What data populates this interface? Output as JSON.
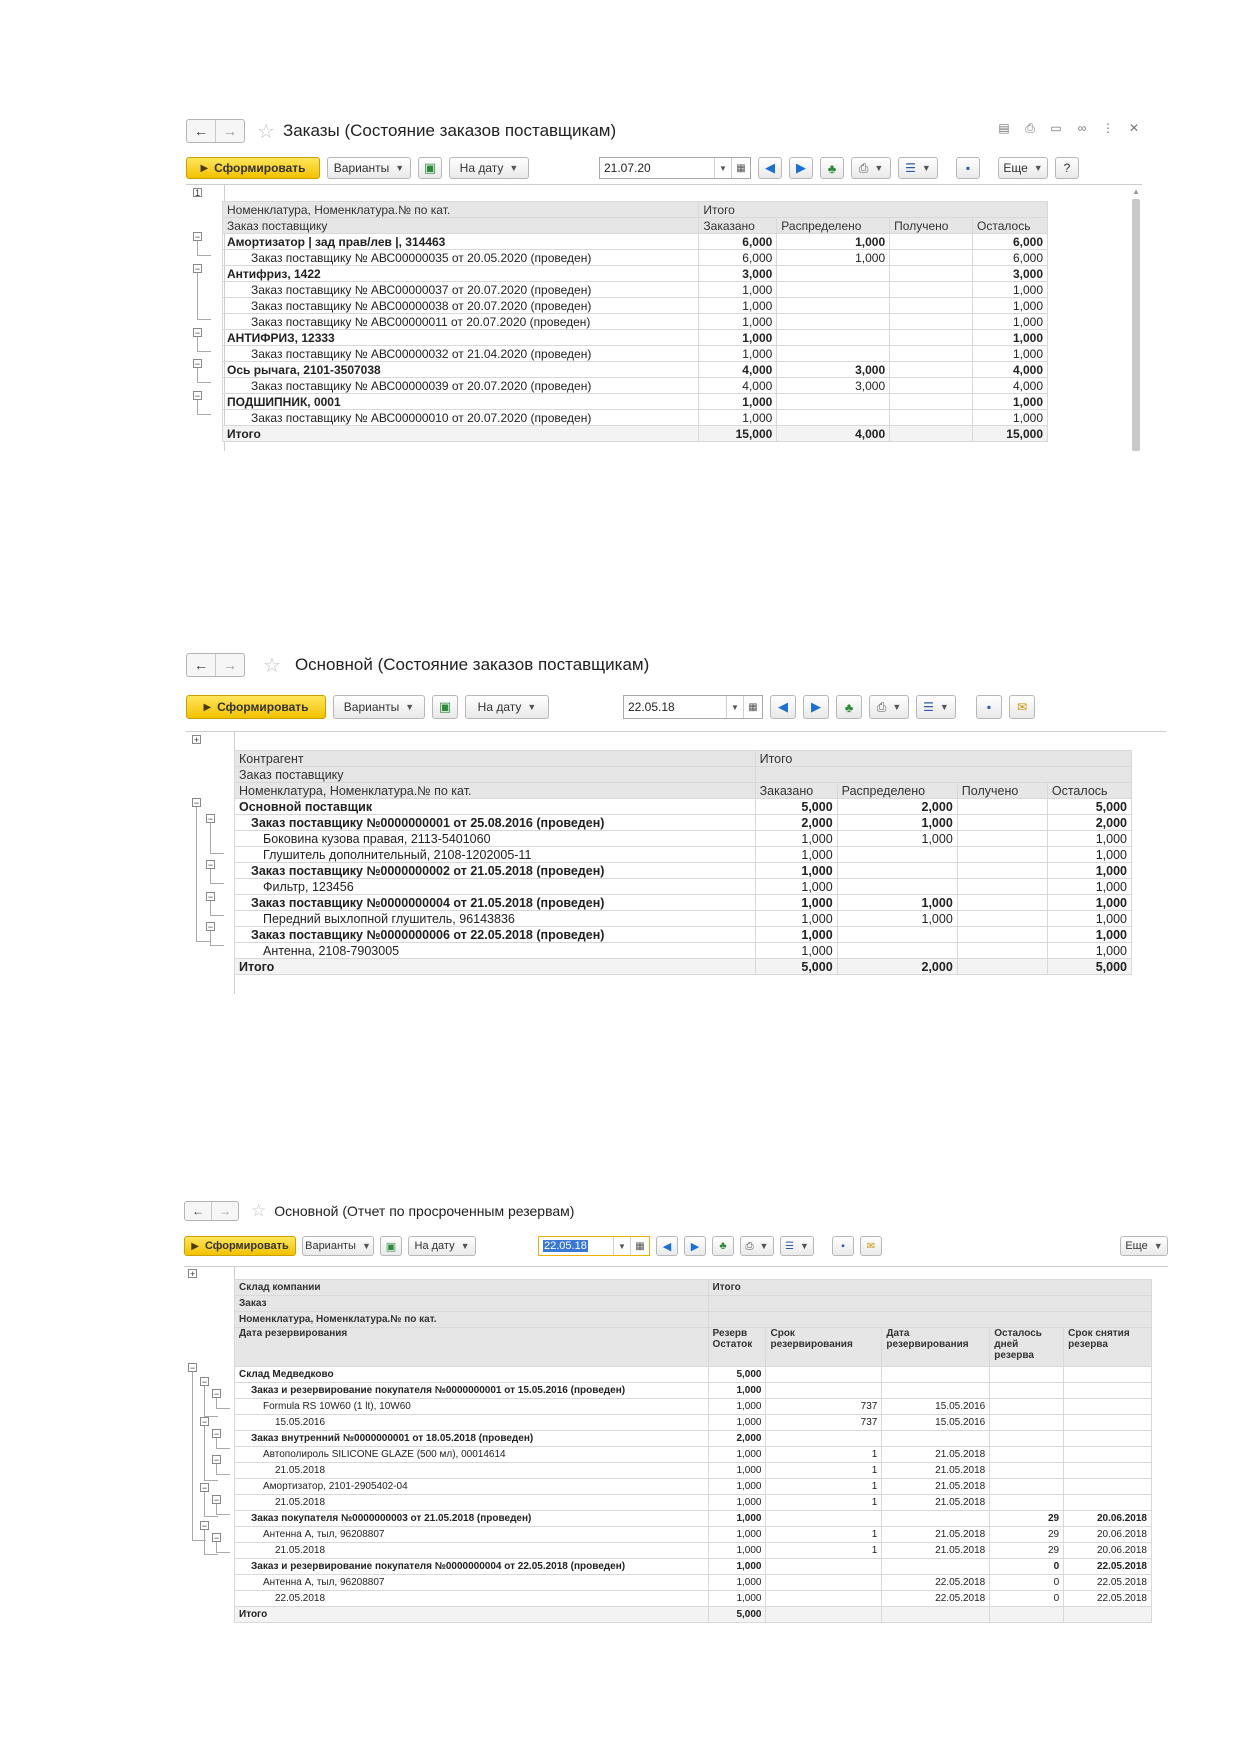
{
  "report1": {
    "title": "Заказы (Состояние заказов поставщикам)",
    "toolbar": {
      "generate": "Сформировать",
      "variants": "Варианты",
      "on_date": "На дату",
      "date_value": "21.07.20",
      "more": "Еще",
      "help": "?"
    },
    "header1": {
      "c0": "Номенклатура, Номенклатура.№ по кат.",
      "c1": "Итого"
    },
    "header2": {
      "c0": "Заказ поставщику",
      "c1": "Заказано",
      "c2": "Распределено",
      "c3": "Получено",
      "c4": "Осталось"
    },
    "rows": [
      {
        "label": "Амортизатор | зад прав/лев |, 314463",
        "ordered": "6,000",
        "distributed": "1,000",
        "received": "",
        "remaining": "6,000",
        "bold": true
      },
      {
        "label": "Заказ поставщику № АВС00000035 от 20.05.2020 (проведен)",
        "ordered": "6,000",
        "distributed": "1,000",
        "received": "",
        "remaining": "6,000",
        "bold": false
      },
      {
        "label": "Антифриз, 1422",
        "ordered": "3,000",
        "distributed": "",
        "received": "",
        "remaining": "3,000",
        "bold": true
      },
      {
        "label": "Заказ поставщику № АВС00000037 от 20.07.2020 (проведен)",
        "ordered": "1,000",
        "distributed": "",
        "received": "",
        "remaining": "1,000",
        "bold": false
      },
      {
        "label": "Заказ поставщику № АВС00000038 от 20.07.2020 (проведен)",
        "ordered": "1,000",
        "distributed": "",
        "received": "",
        "remaining": "1,000",
        "bold": false
      },
      {
        "label": "Заказ поставщику № АВС00000011 от 20.07.2020 (проведен)",
        "ordered": "1,000",
        "distributed": "",
        "received": "",
        "remaining": "1,000",
        "bold": false
      },
      {
        "label": "АНТИФРИЗ, 12333",
        "ordered": "1,000",
        "distributed": "",
        "received": "",
        "remaining": "1,000",
        "bold": true
      },
      {
        "label": "Заказ поставщику № АВС00000032 от 21.04.2020 (проведен)",
        "ordered": "1,000",
        "distributed": "",
        "received": "",
        "remaining": "1,000",
        "bold": false
      },
      {
        "label": "Ось рычага, 2101-3507038",
        "ordered": "4,000",
        "distributed": "3,000",
        "received": "",
        "remaining": "4,000",
        "bold": true
      },
      {
        "label": "Заказ поставщику № АВС00000039 от 20.07.2020 (проведен)",
        "ordered": "4,000",
        "distributed": "3,000",
        "received": "",
        "remaining": "4,000",
        "bold": false
      },
      {
        "label": "ПОДШИПНИК, 0001",
        "ordered": "1,000",
        "distributed": "",
        "received": "",
        "remaining": "1,000",
        "bold": true
      },
      {
        "label": "Заказ поставщику № АВС00000010 от 20.07.2020 (проведен)",
        "ordered": "1,000",
        "distributed": "",
        "received": "",
        "remaining": "1,000",
        "bold": false
      }
    ],
    "total": {
      "label": "Итого",
      "ordered": "15,000",
      "distributed": "4,000",
      "received": "",
      "remaining": "15,000"
    }
  },
  "report2": {
    "title": "Основной (Состояние заказов поставщикам)",
    "toolbar": {
      "generate": "Сформировать",
      "variants": "Варианты",
      "on_date": "На дату",
      "date_value": "22.05.18"
    },
    "header1": {
      "c0": "Контрагент",
      "c1": "Итого"
    },
    "header2": {
      "c0": "Заказ поставщику"
    },
    "header3": {
      "c0": "Номенклатура, Номенклатура.№ по кат.",
      "c1": "Заказано",
      "c2": "Распределено",
      "c3": "Получено",
      "c4": "Осталось"
    },
    "rows": [
      {
        "label": "Основной поставщик",
        "ordered": "5,000",
        "distributed": "2,000",
        "received": "",
        "remaining": "5,000",
        "bold": true
      },
      {
        "label": "Заказ поставщику №0000000001 от 25.08.2016 (проведен)",
        "ordered": "2,000",
        "distributed": "1,000",
        "received": "",
        "remaining": "2,000",
        "bold": true
      },
      {
        "label": "Боковина кузова правая, 2113-5401060",
        "ordered": "1,000",
        "distributed": "1,000",
        "received": "",
        "remaining": "1,000",
        "bold": false
      },
      {
        "label": "Глушитель дополнительный, 2108-1202005-11",
        "ordered": "1,000",
        "distributed": "",
        "received": "",
        "remaining": "1,000",
        "bold": false
      },
      {
        "label": "Заказ поставщику №0000000002 от 21.05.2018 (проведен)",
        "ordered": "1,000",
        "distributed": "",
        "received": "",
        "remaining": "1,000",
        "bold": true
      },
      {
        "label": "Фильтр, 123456",
        "ordered": "1,000",
        "distributed": "",
        "received": "",
        "remaining": "1,000",
        "bold": false
      },
      {
        "label": "Заказ поставщику №0000000004 от 21.05.2018 (проведен)",
        "ordered": "1,000",
        "distributed": "1,000",
        "received": "",
        "remaining": "1,000",
        "bold": true
      },
      {
        "label": "Передний выхлопной глушитель, 96143836",
        "ordered": "1,000",
        "distributed": "1,000",
        "received": "",
        "remaining": "1,000",
        "bold": false
      },
      {
        "label": "Заказ поставщику №0000000006 от 22.05.2018 (проведен)",
        "ordered": "1,000",
        "distributed": "",
        "received": "",
        "remaining": "1,000",
        "bold": true
      },
      {
        "label": "Антенна, 2108-7903005",
        "ordered": "1,000",
        "distributed": "",
        "received": "",
        "remaining": "1,000",
        "bold": false
      }
    ],
    "total": {
      "label": "Итого",
      "ordered": "5,000",
      "distributed": "2,000",
      "received": "",
      "remaining": "5,000"
    }
  },
  "report3": {
    "title": "Основной (Отчет по просроченным резервам)",
    "toolbar": {
      "generate": "Сформировать",
      "variants": "Варианты",
      "on_date": "На дату",
      "date_value": "22.05.18",
      "more": "Еще"
    },
    "header": {
      "h1": "Склад компании",
      "h2": "Заказ",
      "h3": "Номенклатура, Номенклатура.№ по кат.",
      "h4": "Дата резервирования",
      "total": "Итого",
      "c1": "Резерв Остаток",
      "c2": "Срок резервирования",
      "c3": "Дата резервирования",
      "c4": "Осталось дней резерва",
      "c5": "Срок снятия резерва"
    },
    "rows": [
      {
        "label": "Склад Медведково",
        "reserve": "5,000",
        "term": "",
        "date": "",
        "days": "",
        "release": "",
        "bold": true
      },
      {
        "label": "Заказ и резервирование покупателя №0000000001 от 15.05.2016 (проведен)",
        "reserve": "1,000",
        "term": "",
        "date": "",
        "days": "",
        "release": "",
        "bold": true
      },
      {
        "label": "Formula RS 10W60 (1 lt), 10W60",
        "reserve": "1,000",
        "term": "737",
        "date": "15.05.2016",
        "days": "",
        "release": "",
        "bold": false
      },
      {
        "label": "15.05.2016",
        "reserve": "1,000",
        "term": "737",
        "date": "15.05.2016",
        "days": "",
        "release": "",
        "bold": false
      },
      {
        "label": "Заказ внутренний №0000000001 от 18.05.2018 (проведен)",
        "reserve": "2,000",
        "term": "",
        "date": "",
        "days": "",
        "release": "",
        "bold": true
      },
      {
        "label": "Автополироль SILICONE GLAZE (500 мл), 00014614",
        "reserve": "1,000",
        "term": "1",
        "date": "21.05.2018",
        "days": "",
        "release": "",
        "bold": false
      },
      {
        "label": "21.05.2018",
        "reserve": "1,000",
        "term": "1",
        "date": "21.05.2018",
        "days": "",
        "release": "",
        "bold": false
      },
      {
        "label": "Амортизатор, 2101-2905402-04",
        "reserve": "1,000",
        "term": "1",
        "date": "21.05.2018",
        "days": "",
        "release": "",
        "bold": false
      },
      {
        "label": "21.05.2018",
        "reserve": "1,000",
        "term": "1",
        "date": "21.05.2018",
        "days": "",
        "release": "",
        "bold": false
      },
      {
        "label": "Заказ покупателя №0000000003 от 21.05.2018 (проведен)",
        "reserve": "1,000",
        "term": "",
        "date": "",
        "days": "29",
        "release": "20.06.2018",
        "bold": true
      },
      {
        "label": "Антенна А, тыл, 96208807",
        "reserve": "1,000",
        "term": "1",
        "date": "21.05.2018",
        "days": "29",
        "release": "20.06.2018",
        "bold": false
      },
      {
        "label": "21.05.2018",
        "reserve": "1,000",
        "term": "1",
        "date": "21.05.2018",
        "days": "29",
        "release": "20.06.2018",
        "bold": false
      },
      {
        "label": "Заказ и резервирование покупателя №0000000004 от 22.05.2018 (проведен)",
        "reserve": "1,000",
        "term": "",
        "date": "",
        "days": "0",
        "release": "22.05.2018",
        "bold": true
      },
      {
        "label": "Антенна А, тыл, 96208807",
        "reserve": "1,000",
        "term": "",
        "date": "22.05.2018",
        "days": "0",
        "release": "22.05.2018",
        "bold": false
      },
      {
        "label": "22.05.2018",
        "reserve": "1,000",
        "term": "",
        "date": "22.05.2018",
        "days": "0",
        "release": "22.05.2018",
        "bold": false
      }
    ],
    "total": {
      "label": "Итого",
      "reserve": "5,000"
    }
  }
}
